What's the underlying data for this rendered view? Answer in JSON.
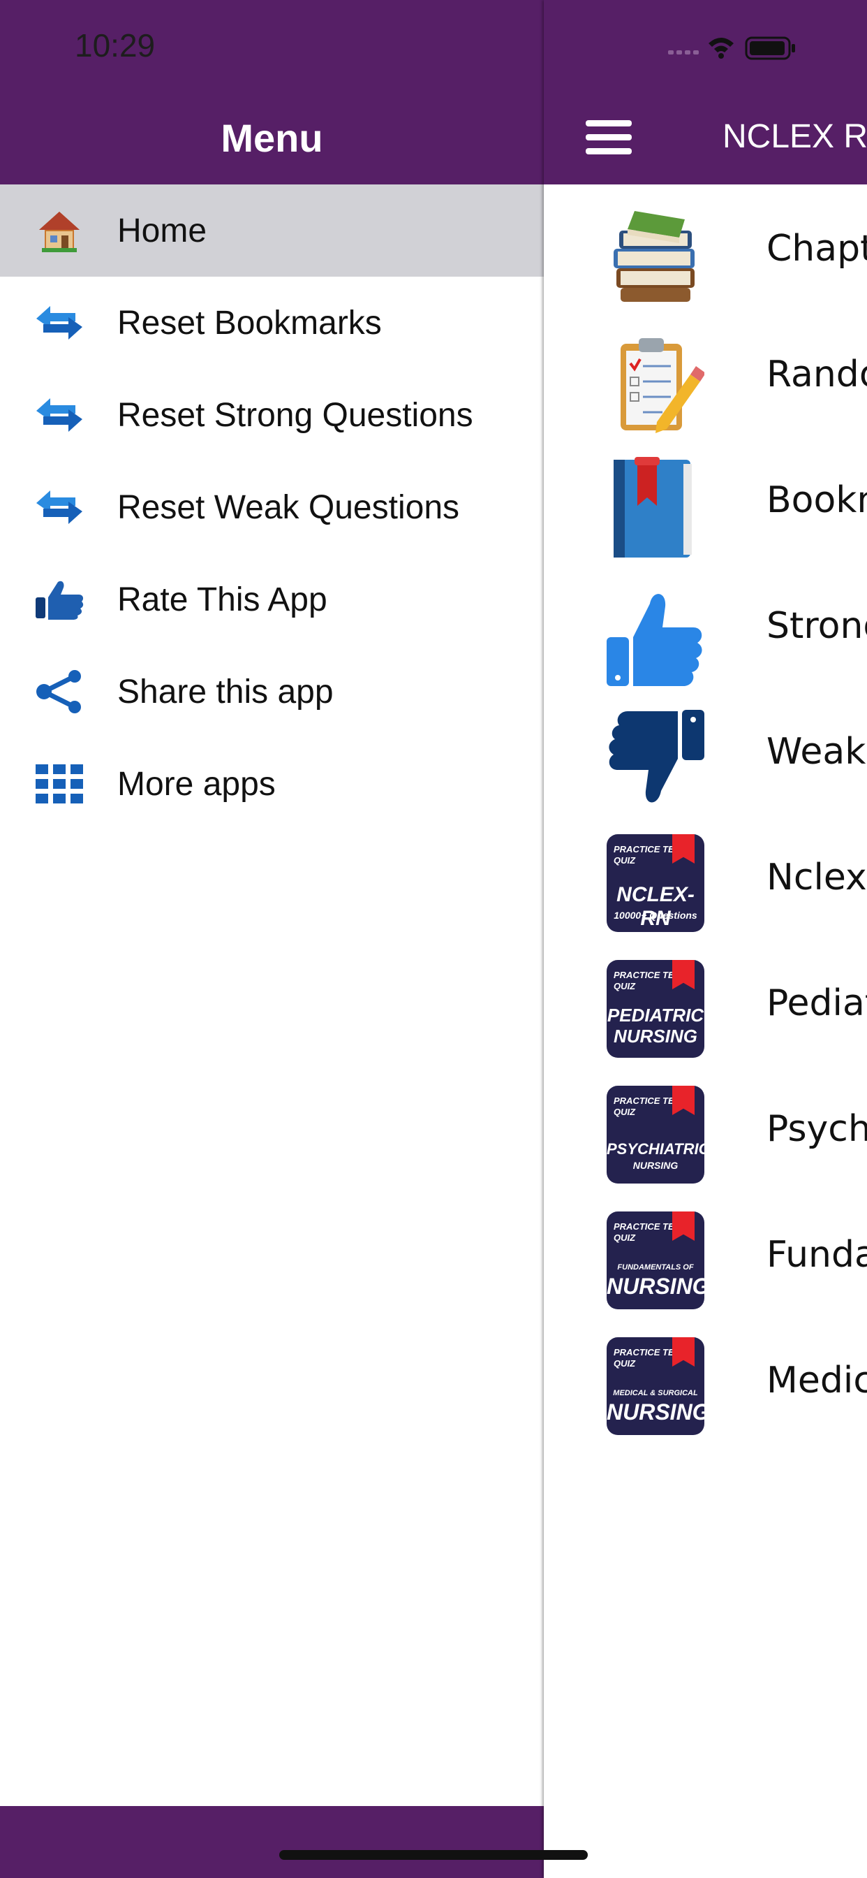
{
  "status_bar": {
    "time": "10:29"
  },
  "drawer": {
    "title": "Menu",
    "items": [
      {
        "label": "Home",
        "icon": "home-icon",
        "selected": true
      },
      {
        "label": "Reset Bookmarks",
        "icon": "refresh-icon"
      },
      {
        "label": "Reset Strong Questions",
        "icon": "refresh-icon"
      },
      {
        "label": "Reset Weak Questions",
        "icon": "refresh-icon"
      },
      {
        "label": "Rate This App",
        "icon": "thumbs-up-icon"
      },
      {
        "label": "Share this app",
        "icon": "share-icon"
      },
      {
        "label": "More apps",
        "icon": "grid-icon"
      }
    ],
    "colors": {
      "header": "#561f66",
      "selected": "#d1d1d6",
      "icon_blue": "#1f6fd1"
    }
  },
  "main": {
    "title": "NCLEX R",
    "rows": [
      {
        "label": "Chapte",
        "icon": "books-icon"
      },
      {
        "label": "Rando",
        "icon": "clipboard-icon"
      },
      {
        "label": "Bookm",
        "icon": "bookmark-book-icon"
      },
      {
        "label": "Strong",
        "icon": "thumbs-up-icon"
      },
      {
        "label": "Weak",
        "icon": "thumbs-down-icon"
      },
      {
        "label": "Nclex-",
        "icon": "app-badge-icon",
        "badge": {
          "top": "PRACTICE TEST\nQUIZ",
          "main": "NCLEX-RN",
          "sub": "10000+ Questions"
        }
      },
      {
        "label": "Pediat",
        "icon": "app-badge-icon",
        "badge": {
          "top": "PRACTICE TEST\nQUIZ",
          "main": "PEDIATRIC\nNURSING",
          "sub": ""
        }
      },
      {
        "label": "Psychi",
        "icon": "app-badge-icon",
        "badge": {
          "top": "PRACTICE TEST\nQUIZ",
          "main": "PSYCHIATRIC",
          "sub": "NURSING"
        }
      },
      {
        "label": "Funda",
        "icon": "app-badge-icon",
        "badge": {
          "top": "PRACTICE TEST\nQUIZ",
          "main": "NURSING",
          "sub": "FUNDAMENTALS OF"
        }
      },
      {
        "label": "Medic",
        "icon": "app-badge-icon",
        "badge": {
          "top": "PRACTICE TEST\nQUIZ",
          "main": "NURSING",
          "sub": "MEDICAL & SURGICAL"
        }
      }
    ]
  }
}
